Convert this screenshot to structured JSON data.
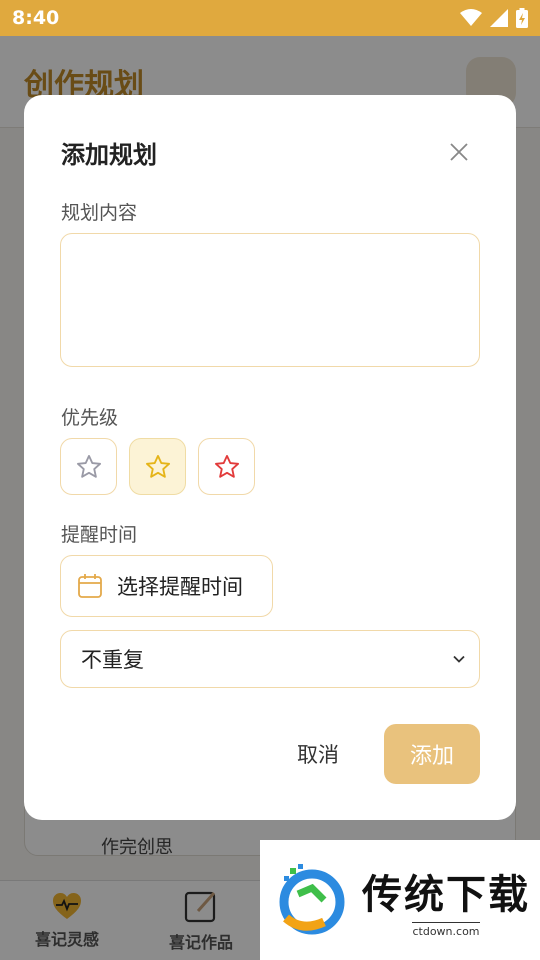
{
  "status_bar": {
    "time": "8:40"
  },
  "page": {
    "title": "创作规划",
    "card_text": "作完创思"
  },
  "dialog": {
    "title": "添加规划",
    "content_label": "规划内容",
    "content_value": "",
    "priority_label": "优先级",
    "priority_options": [
      {
        "icon": "star-outline-icon",
        "color": "#9a9aa6"
      },
      {
        "icon": "star-outline-icon",
        "color": "#e5b418",
        "selected": true
      },
      {
        "icon": "star-outline-icon",
        "color": "#e23b3b"
      }
    ],
    "reminder_label": "提醒时间",
    "reminder_button": "选择提醒时间",
    "repeat_value": "不重复",
    "cancel_label": "取消",
    "add_label": "添加"
  },
  "bottom_nav": {
    "items": [
      {
        "label": "喜记灵感",
        "icon": "heart-pulse-icon"
      },
      {
        "label": "喜记作品",
        "icon": "edit-note-icon"
      }
    ]
  },
  "watermark": {
    "title": "传统下载",
    "url": "ctdown.com"
  },
  "colors": {
    "accent": "#e0a93e",
    "button_primary": "#e9c27d",
    "border": "#f1d9a9"
  }
}
